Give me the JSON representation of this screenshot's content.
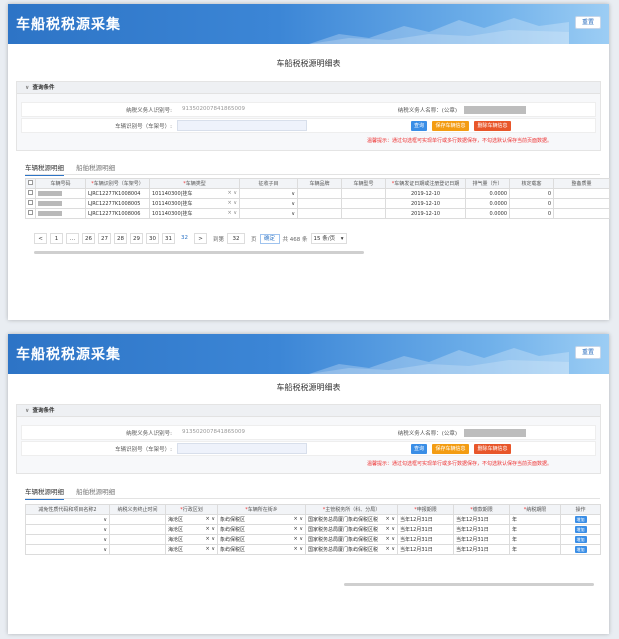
{
  "app": {
    "title": "车船税税源采集",
    "reset_label": "重置"
  },
  "page_title": "车船税税源明细表",
  "query": {
    "section_label": "查询条件",
    "taxpayer_id_label": "纳税义务人识别号:",
    "taxpayer_id_value": "913502007841865009",
    "taxpayer_name_label": "纳税义务人名称：(公章)",
    "vehicle_id_label": "车辆识别号（车架号）:",
    "buttons": {
      "query": "查询",
      "save": "保存车辆信息",
      "delete": "删除车辆信息"
    },
    "tip": "温馨提示：通过勾选框可实现单行或多行数据保存，不勾选默认保存当前页面数据。"
  },
  "tabs": {
    "vehicle": "车辆税源明细",
    "ship": "船舶税源明细"
  },
  "table1": {
    "headers": [
      "",
      "车辆号码",
      "车辆识别号（车架号）",
      "车辆类型",
      "征收子目",
      "车辆品牌",
      "车辆型号",
      "车辆发证日期或注册登记日期",
      "排气量（升）",
      "核定载客",
      "整备质量"
    ],
    "required": [
      false,
      false,
      true,
      true,
      false,
      false,
      false,
      true,
      false,
      false,
      false
    ],
    "rows": [
      {
        "vin": "LJRC12277K1008004",
        "type": "101140300|挂车",
        "date": "2019-12-10",
        "displacement": "0.0000",
        "seats": "0"
      },
      {
        "vin": "LJRC12277K1008005",
        "type": "101140300|挂车",
        "date": "2019-12-10",
        "displacement": "0.0000",
        "seats": "0"
      },
      {
        "vin": "LJRC12277K1008006",
        "type": "101140300|挂车",
        "date": "2019-12-10",
        "displacement": "0.0000",
        "seats": "0"
      }
    ]
  },
  "pager": {
    "prev": "<",
    "next": ">",
    "pages": [
      "1",
      "...",
      "26",
      "27",
      "28",
      "29",
      "30",
      "31",
      "32"
    ],
    "current": "32",
    "goto_label": "到第",
    "goto_value": "32",
    "page_unit": "页",
    "confirm": "确定",
    "total": "共 468 条",
    "page_size": "15 条/页"
  },
  "table2": {
    "headers": [
      "减免性质代码和项目名称2",
      "纳税义务终止时间",
      "行政区划",
      "车辆所在街乡",
      "主管税务所（科、分局）",
      "申报期限",
      "缴款期限",
      "纳税期限",
      "操作"
    ],
    "required": [
      false,
      false,
      true,
      true,
      true,
      true,
      true,
      true,
      false
    ],
    "rows": [
      {
        "district": "海沧区",
        "street": "象屿保税区",
        "office": "国家税务总局厦门象屿保税区税",
        "declare": "当年12月31日",
        "pay": "当年12月31日",
        "period": "年",
        "op": "增加"
      },
      {
        "district": "海沧区",
        "street": "象屿保税区",
        "office": "国家税务总局厦门象屿保税区税",
        "declare": "当年12月31日",
        "pay": "当年12月31日",
        "period": "年",
        "op": "增加"
      },
      {
        "district": "海沧区",
        "street": "象屿保税区",
        "office": "国家税务总局厦门象屿保税区税",
        "declare": "当年12月31日",
        "pay": "当年12月31日",
        "period": "年",
        "op": "增加"
      },
      {
        "district": "海沧区",
        "street": "象屿保税区",
        "office": "国家税务总局厦门象屿保税区税",
        "declare": "当年12月31日",
        "pay": "当年12月31日",
        "period": "年",
        "op": "增加"
      }
    ]
  }
}
